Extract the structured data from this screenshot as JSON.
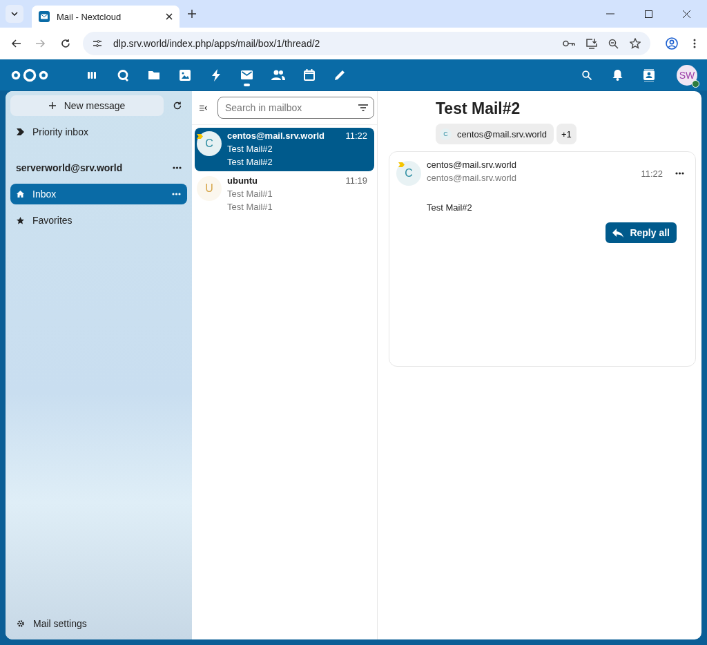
{
  "browser": {
    "tab_title": "Mail - Nextcloud",
    "url": "dlp.srv.world/index.php/apps/mail/box/1/thread/2"
  },
  "header": {
    "avatar_initials": "SW",
    "apps": [
      {
        "kind": "dashboard",
        "selected": false
      },
      {
        "kind": "talk",
        "selected": false
      },
      {
        "kind": "files",
        "selected": false
      },
      {
        "kind": "photos",
        "selected": false
      },
      {
        "kind": "activity",
        "selected": false
      },
      {
        "kind": "mail",
        "selected": true
      },
      {
        "kind": "contacts",
        "selected": false
      },
      {
        "kind": "calendar",
        "selected": false
      },
      {
        "kind": "notes",
        "selected": false
      }
    ]
  },
  "sidebar": {
    "new_message": "New message",
    "priority": "Priority inbox",
    "account": "serverworld@srv.world",
    "items": [
      {
        "label": "Inbox",
        "kind": "inbox",
        "selected": true
      },
      {
        "label": "Favorites",
        "kind": "favorites",
        "selected": false
      }
    ],
    "settings": "Mail settings"
  },
  "list": {
    "search_placeholder": "Search in mailbox",
    "messages": [
      {
        "initial": "C",
        "color": "#2a8ca0",
        "from": "centos@mail.srv.world",
        "time": "11:22",
        "subject": "Test Mail#2",
        "preview": "Test Mail#2",
        "important": true,
        "selected": true
      },
      {
        "initial": "U",
        "color": "#d6a548",
        "from": "ubuntu",
        "time": "11:19",
        "subject": "Test Mail#1",
        "preview": "Test Mail#1",
        "important": false,
        "selected": false
      }
    ]
  },
  "thread": {
    "subject": "Test Mail#2",
    "participant_initial": "C",
    "participant": "centos@mail.srv.world",
    "more": "+1",
    "message": {
      "initial": "C",
      "from_name": "centos@mail.srv.world",
      "from_address": "centos@mail.srv.world",
      "time": "11:22",
      "important": true,
      "body": "Test Mail#2",
      "reply": "Reply all"
    }
  }
}
